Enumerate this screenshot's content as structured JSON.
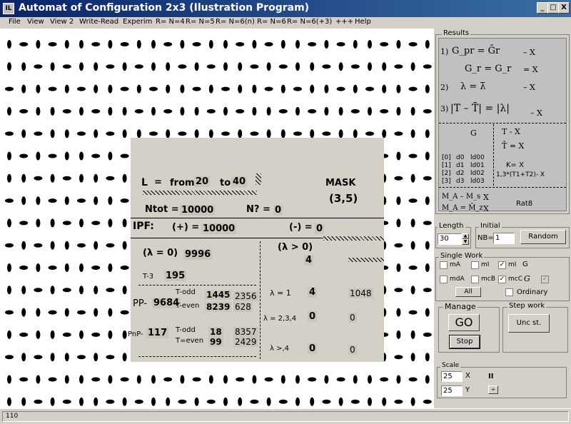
{
  "window": {
    "icon_text": "IL",
    "title": "Automat of Configuration 2x3 (Ilustration Program)",
    "min": "_",
    "max": "□",
    "close": "X"
  },
  "menu": [
    "File",
    "View",
    "View 2",
    "Write-Read",
    "Experim",
    "R= N=4",
    "R= N=5",
    "R= N=6(n)",
    "R= N=6",
    "R= N=6(+3)",
    "+++",
    "Help"
  ],
  "info": {
    "L": "L",
    "eq": "=",
    "from": "from",
    "from_val": "20",
    "to": "to",
    "to_val": "40",
    "mask": "MASK",
    "mask_val": "(3,5)",
    "ntot": "Ntot =",
    "ntot_val": "10000",
    "nq": "N? =",
    "nq_val": "0",
    "ipf": "IPF:",
    "plus": "(+) =",
    "plus_val": "10000",
    "minus": "(-) =",
    "minus_val": "0",
    "lam0": "(λ = 0)",
    "lam0_val": "9996",
    "lampos": "(λ > 0)",
    "lampos_val": "4",
    "t3": "T-3",
    "t3_val": "195",
    "pp": "PP-",
    "pp_val": "9684",
    "tto": "T-odd",
    "tto_v1": "1445",
    "tto_v2": "2356",
    "tte": "T-even",
    "tte_v1": "8239",
    "tte_v2": "628",
    "pnp": "PnP-",
    "pnp_val": "117",
    "pto": "T-odd",
    "pto_v1": "18",
    "pto_v2": "8357",
    "pte": "T=even",
    "pte_v1": "99",
    "pte_v2": "2429",
    "l1": "λ = 1",
    "l1_v1": "4",
    "l1_v2": "1048",
    "l234": "λ = 2,3,4",
    "l234_v1": "0",
    "l234_v2": "0",
    "l4": "λ >,4",
    "l4_v1": "0",
    "l4_v2": "0"
  },
  "results": {
    "label": "Results",
    "r1": "1)",
    "r1_formula": "G_pr = Ḡr",
    "r1_val": "– X",
    "r1b_formula": "G_r = G_r",
    "r1b_val": "= X",
    "r2": "2)",
    "r2_formula": "λ = λ̄",
    "r2_val": "– X",
    "r3": "3)",
    "r3_formula": "|T – T̄| = |λ|",
    "r3_val": "– X",
    "g_head": "G",
    "t_head": "T - X",
    "tbar": "T̄ = X",
    "rows": [
      [
        "[0]",
        "d0",
        "ld00"
      ],
      [
        "[1]",
        "d1",
        "ld01"
      ],
      [
        "[2]",
        "d2",
        "ld02"
      ],
      [
        "[3]",
        "d3",
        "ld03"
      ]
    ],
    "k": "K= X",
    "formula": "1,3*(T1+T2)- X",
    "ma1": "M_A – M_s",
    "ma1_val": "X",
    "ma2": "M_A = M̄_z",
    "ma2_val": "X",
    "rat": "Rat8"
  },
  "length": {
    "label": "Length",
    "value": "30"
  },
  "initial": {
    "label": "Initial",
    "nb_label": "NB=",
    "nb_value": "1",
    "random": "Random"
  },
  "single_work": {
    "label": "Single Work",
    "checks": [
      {
        "label": "mA",
        "checked": ""
      },
      {
        "label": "mI",
        "checked": ""
      },
      {
        "label": "mI",
        "checked": "✓"
      },
      {
        "label": "G",
        "checked": ""
      },
      {
        "label": "mdA",
        "checked": ""
      },
      {
        "label": "mcB",
        "checked": ""
      },
      {
        "label": "mcC",
        "checked": "✓"
      },
      {
        "label": "G",
        "checked": "✓"
      }
    ],
    "all": "All",
    "ordinary": "Ordinary"
  },
  "manage": {
    "label": "Manage",
    "go": "GO",
    "stop": "Stop"
  },
  "step": {
    "label": "Step work",
    "button": "Unc st."
  },
  "scale": {
    "label": "Scale",
    "x_val": "25",
    "x_label": "X",
    "y_val": "25",
    "y_label": "Y"
  },
  "status": {
    "text": "110"
  }
}
